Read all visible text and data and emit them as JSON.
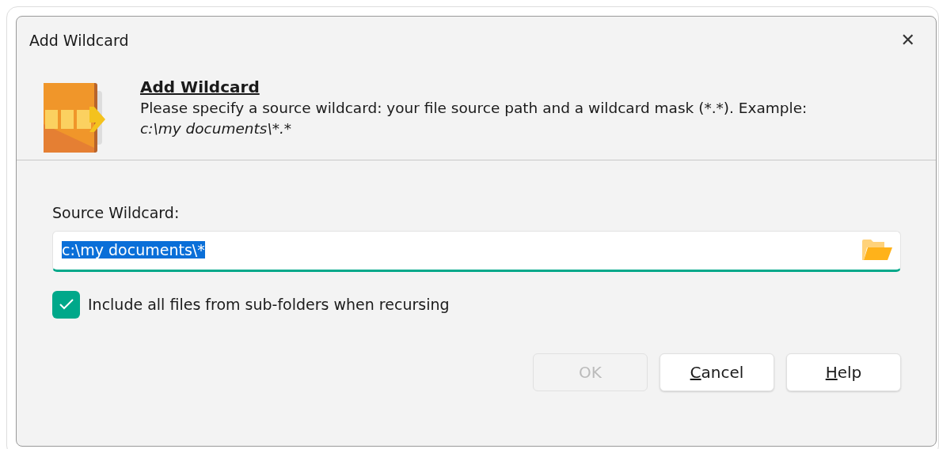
{
  "window": {
    "title": "Add Wildcard",
    "close": "✕"
  },
  "header": {
    "title": "Add Wildcard",
    "description": "Please specify a source wildcard: your file source path and a wildcard mask (*.*). Example:",
    "example": "c:\\my documents\\*.*"
  },
  "field": {
    "label": "Source Wildcard:",
    "value": "c:\\my documents\\*",
    "selected": true
  },
  "checkbox": {
    "label": "Include all files from sub-folders when recursing",
    "checked": true
  },
  "buttons": [
    {
      "rest": "OK",
      "disabled": true
    },
    {
      "mnemonic": "C",
      "rest": "ancel",
      "disabled": false
    },
    {
      "mnemonic": "H",
      "rest": "elp",
      "disabled": false
    }
  ]
}
